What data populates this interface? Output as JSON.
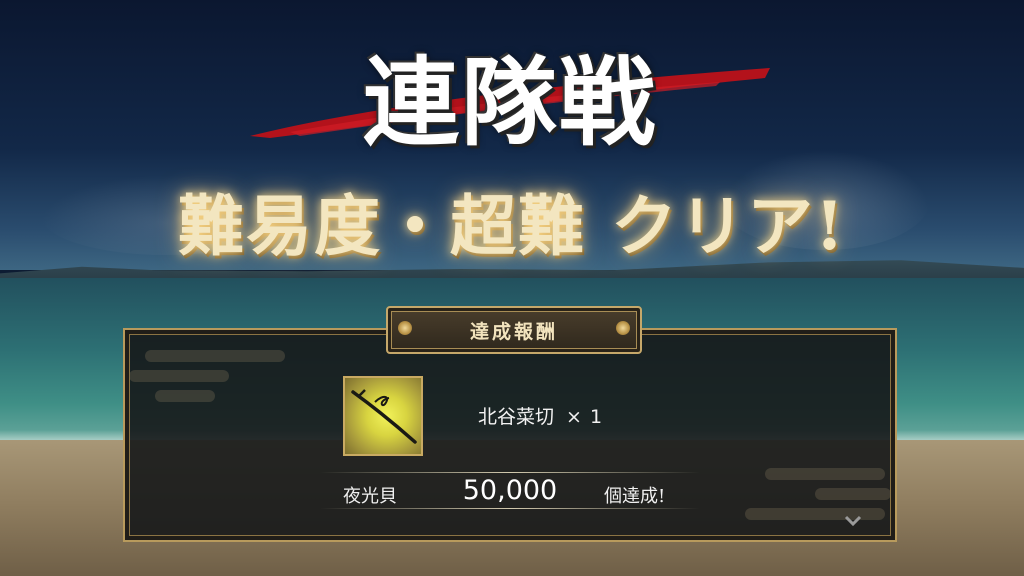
{
  "title": {
    "logo_text": "連隊戦"
  },
  "clear_banner": {
    "text": "難易度・超難 クリア!"
  },
  "reward_panel": {
    "header": "達成報酬",
    "item": {
      "icon": "katana-icon",
      "name": "北谷菜切",
      "multiply": "×",
      "quantity": "1"
    },
    "condition": {
      "label": "夜光貝",
      "value": "50,000",
      "suffix": "個達成!"
    },
    "next_icon": "chevron-down-icon"
  },
  "colors": {
    "accent_gold": "#c6a86a",
    "brush_red": "#b3121b",
    "item_bg_yellow": "#e4e04a",
    "panel_bg": "#16181a"
  }
}
